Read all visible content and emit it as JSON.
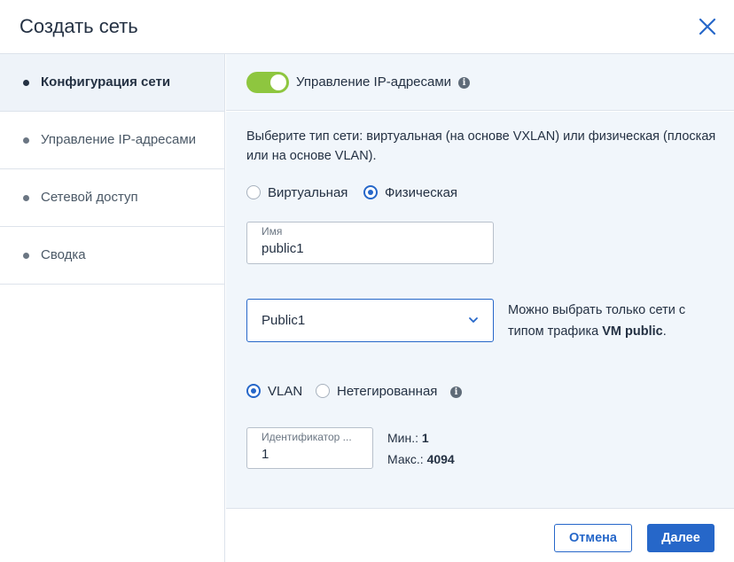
{
  "dialog": {
    "title": "Создать сеть"
  },
  "steps": [
    {
      "label": "Конфигурация сети",
      "active": true
    },
    {
      "label": "Управление IP-адресами",
      "active": false
    },
    {
      "label": "Сетевой доступ",
      "active": false
    },
    {
      "label": "Сводка",
      "active": false
    }
  ],
  "ip_management": {
    "label": "Управление IP-адресами",
    "enabled": true,
    "info": "i"
  },
  "network_type": {
    "description": "Выберите тип сети: виртуальная (на основе VXLAN) или физическая (плоская или на основе VLAN).",
    "options": [
      "Виртуальная",
      "Физическая"
    ],
    "selected": "Физическая"
  },
  "name_field": {
    "label": "Имя",
    "value": "public1"
  },
  "physical_network": {
    "value": "Public1",
    "hint_prefix": "Можно выбрать только сети с типом трафика ",
    "hint_bold": "VM public",
    "hint_suffix": "."
  },
  "vlan_mode": {
    "options": [
      "VLAN",
      "Нетегированная"
    ],
    "selected": "VLAN",
    "info": "i"
  },
  "vlan_id": {
    "label": "Идентификатор ...",
    "value": "1",
    "min_label": "Мин.:",
    "min_value": "1",
    "max_label": "Макс.:",
    "max_value": "4094"
  },
  "footer": {
    "cancel_label": "Отмена",
    "next_label": "Далее"
  },
  "colors": {
    "accent": "#2667c9",
    "toggle_on": "#8ec63f",
    "panel_bg": "#f1f6fb",
    "active_step_bg": "#eef3f9"
  },
  "icons": {
    "close": "close-icon",
    "info": "info-icon",
    "dropdown": "chevron-down-icon"
  }
}
